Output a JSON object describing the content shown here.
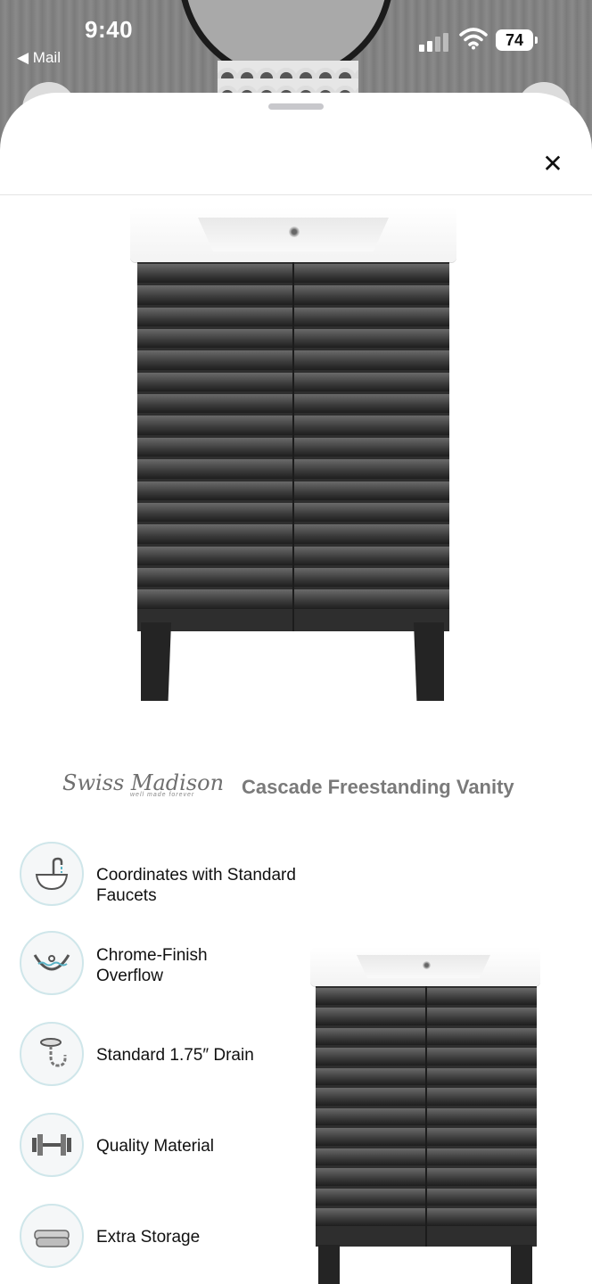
{
  "status_bar": {
    "time": "9:40",
    "back_app": "Mail",
    "battery": "74"
  },
  "sheet": {
    "close_label": "✕"
  },
  "product": {
    "brand": "Swiss Madison",
    "brand_tagline": "well made forever",
    "name": "Cascade Freestanding Vanity"
  },
  "features": [
    {
      "icon": "sink-faucet-icon",
      "label": "Coordinates with Standard Faucets"
    },
    {
      "icon": "overflow-icon",
      "label": "Chrome-Finish\nOverflow"
    },
    {
      "icon": "drain-icon",
      "label": "Standard 1.75″ Drain"
    },
    {
      "icon": "dumbbell-icon",
      "label": "Quality Material"
    },
    {
      "icon": "towel-icon",
      "label": "Extra Storage"
    }
  ],
  "colors": {
    "cabinet": "#2e2e2e",
    "accent_ring": "#cfe6ea",
    "headline_gray": "#7a7a7a"
  }
}
